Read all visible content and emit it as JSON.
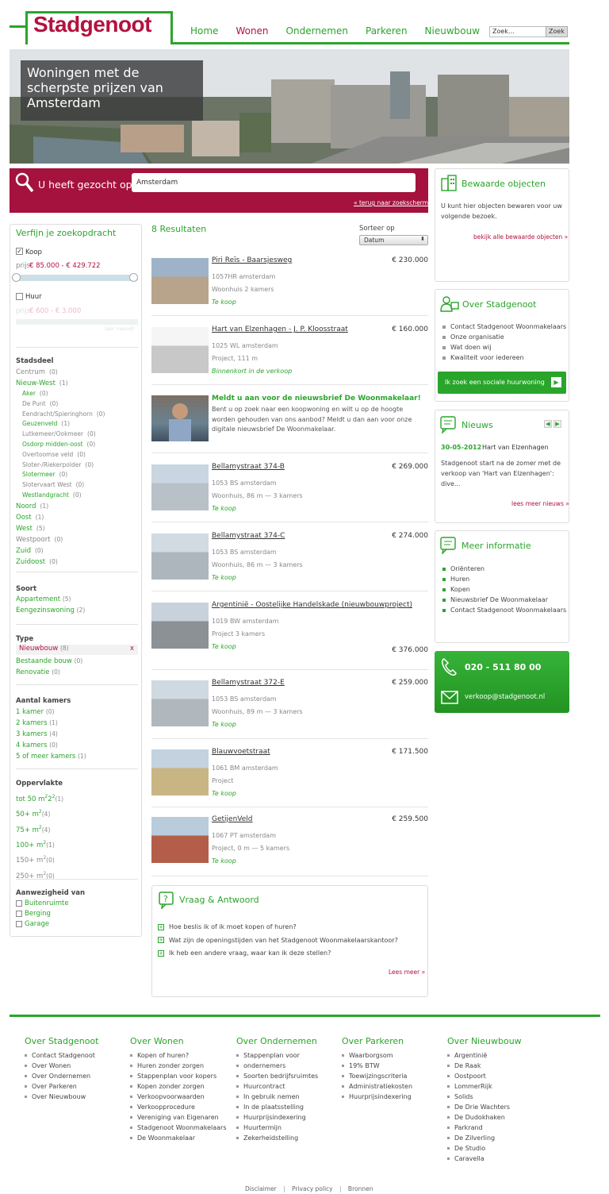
{
  "header": {
    "logo": "Stadgenoot",
    "nav": [
      "Home",
      "Wonen",
      "Ondernemen",
      "Parkeren",
      "Nieuwbouw"
    ],
    "active_nav": "Wonen",
    "search_placeholder": "Zoek...",
    "search_button": "Zoek"
  },
  "hero": {
    "title": "Woningen met de scherpste prijzen van Amsterdam"
  },
  "searchbar": {
    "label": "U heeft gezocht op:",
    "value": "Amsterdam",
    "back_link": "« terug naar zoekscherm"
  },
  "filter": {
    "title": "Verfijn je zoekopdracht",
    "koop_label": "Koop",
    "koop_price_prefix": "prijs",
    "koop_price": "€ 85.000 - € 429.722",
    "huur_label": "Huur",
    "huur_price_prefix": "prijs",
    "huur_price": "€ 600 - € 3.000",
    "huur_note": "(per maand)",
    "stadsdeel_title": "Stadsdeel",
    "stadsdeel": [
      {
        "label": "Centrum",
        "count": "(0)",
        "level": 0,
        "color": "grey"
      },
      {
        "label": "Nieuw-West",
        "count": "(1)",
        "level": 0,
        "color": "green"
      },
      {
        "label": "Aker",
        "count": "(0)",
        "level": 1,
        "color": "green"
      },
      {
        "label": "De Punt",
        "count": "(0)",
        "level": 1,
        "color": "grey"
      },
      {
        "label": "Eendracht/Spieringhorn",
        "count": "(0)",
        "level": 1,
        "color": "grey"
      },
      {
        "label": "Geuzenveld",
        "count": "(1)",
        "level": 1,
        "color": "green"
      },
      {
        "label": "Lutkemeer/Ookmeer",
        "count": "(0)",
        "level": 1,
        "color": "grey"
      },
      {
        "label": "Osdorp midden-oost",
        "count": "(0)",
        "level": 1,
        "color": "green"
      },
      {
        "label": "Overtoomse veld",
        "count": "(0)",
        "level": 1,
        "color": "grey"
      },
      {
        "label": "Sloter-/Riekerpolder",
        "count": "(0)",
        "level": 1,
        "color": "grey"
      },
      {
        "label": "Slotermeer",
        "count": "(0)",
        "level": 1,
        "color": "green"
      },
      {
        "label": "Slotervaart West",
        "count": "(0)",
        "level": 1,
        "color": "grey"
      },
      {
        "label": "Westlandgracht",
        "count": "(0)",
        "level": 1,
        "color": "green"
      },
      {
        "label": "Noord",
        "count": "(1)",
        "level": 0,
        "color": "green"
      },
      {
        "label": "Oost",
        "count": "(1)",
        "level": 0,
        "color": "green"
      },
      {
        "label": "West",
        "count": "(5)",
        "level": 0,
        "color": "green"
      },
      {
        "label": "Westpoort",
        "count": "(0)",
        "level": 0,
        "color": "grey"
      },
      {
        "label": "Zuid",
        "count": "(0)",
        "level": 0,
        "color": "green"
      },
      {
        "label": "Zuidoost",
        "count": "(0)",
        "level": 0,
        "color": "green"
      }
    ],
    "soort_title": "Soort",
    "soort": [
      {
        "label": "Appartement",
        "count": "(5)"
      },
      {
        "label": "Eengezinswoning",
        "count": "(2)"
      }
    ],
    "type_title": "Type",
    "type_selected": {
      "label": "Nieuwbouw",
      "count": "(8)",
      "remove": "x"
    },
    "type": [
      {
        "label": "Bestaande bouw",
        "count": "(0)"
      },
      {
        "label": "Renovatie",
        "count": "(0)"
      }
    ],
    "kamers_title": "Aantal kamers",
    "kamers": [
      {
        "label": "1 kamer",
        "count": "(0)"
      },
      {
        "label": "2 kamers",
        "count": "(1)"
      },
      {
        "label": "3 kamers",
        "count": "(4)"
      },
      {
        "label": "4 kamers",
        "count": "(0)"
      },
      {
        "label": "5 of meer kamers",
        "count": "(1)"
      }
    ],
    "opp_title": "Oppervlakte",
    "opp": [
      {
        "label": "tot 50 m",
        "count": "(1)",
        "color": "green"
      },
      {
        "label": "50+ m",
        "count": "(4)",
        "color": "green"
      },
      {
        "label": "75+ m",
        "count": "(4)",
        "color": "green"
      },
      {
        "label": "100+ m",
        "count": "(1)",
        "color": "green"
      },
      {
        "label": "150+ m",
        "count": "(0)",
        "color": "grey"
      },
      {
        "label": "250+ m",
        "count": "(0)",
        "color": "grey"
      }
    ],
    "aanw_title": "Aanwezigheid van",
    "aanw": [
      "Buitenruimte",
      "Berging",
      "Garage"
    ]
  },
  "results": {
    "count_label": "8 Resultaten",
    "sort_label": "Sorteer op",
    "sort_value": "Datum",
    "items": [
      {
        "title": "Piri Reïs - Baarsjesweg",
        "price": "€ 230.000",
        "addr": "1057HR amsterdam",
        "type": "Woonhuis 2 kamers",
        "status": "Te koop"
      },
      {
        "title": "Hart van Elzenhagen - J. P. Kloosstraat",
        "price": "€ 160.000",
        "addr": "1025 WL amsterdam",
        "type": "Project, 111 m",
        "status": "Binnenkort in de verkoop"
      },
      {
        "title": "Bellamystraat 374-B",
        "price": "€ 269.000",
        "addr": "1053 BS amsterdam",
        "type": "Woonhuis, 86 m — 3 kamers",
        "status": "Te koop"
      },
      {
        "title": "Bellamystraat 374-C",
        "price": "€ 274.000",
        "addr": "1053 BS amsterdam",
        "type": "Woonhuis, 86 m — 3 kamers",
        "status": "Te koop"
      },
      {
        "title": "Argentinië - Oostelijke Handelskade (nieuwbouwproject)",
        "price": "€ 376.000",
        "addr": "1019 BW amsterdam",
        "type": "Project 3 kamers",
        "status": "Te koop"
      },
      {
        "title": "Bellamystraat 372-E",
        "price": "€ 259.000",
        "addr": "1053 BS amsterdam",
        "type": "Woonhuis, 89 m — 3 kamers",
        "status": "Te koop"
      },
      {
        "title": "Blauwvoetstraat",
        "price": "€ 171.500",
        "addr": "1061 BM amsterdam",
        "type": "Project",
        "status": "Te koop"
      },
      {
        "title": "GetijenVeld",
        "price": "€ 259.500",
        "addr": "1067 PT amsterdam",
        "type": "Project, 0 m — 5 kamers",
        "status": "Te koop"
      }
    ],
    "promo_title": "Meldt u aan voor de nieuwsbrief De Woonmakelaar!",
    "promo_text": "Bent u op zoek naar een koopwoning en wilt u op de hoogte worden gehouden van ons aanbod? Meldt u dan aan voor onze digitale nieuwsbrief De Woonmakelaar."
  },
  "faq": {
    "title": "Vraag & Antwoord",
    "items": [
      "Hoe beslis ik of ik moet kopen of huren?",
      "Wat zijn de openingstijden van het Stadgenoot Woonmakelaarskantoor?",
      "Ik heb een andere vraag, waar kan ik deze stellen?"
    ],
    "more": "Lees meer »"
  },
  "sidebar": {
    "saved_title": "Bewaarde objecten",
    "saved_text": "U kunt hier objecten bewaren voor uw volgende bezoek.",
    "saved_link": "bekijk alle bewaarde objecten »",
    "over_title": "Over Stadgenoot",
    "over_items": [
      "Contact Stadgenoot Woonmakelaars",
      "Onze organisatie",
      "Wat doen wij",
      "Kwaliteit voor iedereen"
    ],
    "social_btn": "Ik zoek een sociale huurwoning",
    "news_title": "Nieuws",
    "news_date": "30-05-2012",
    "news_head": "Hart van Elzenhagen",
    "news_text": "Stadgenoot start na de zomer met de verkoop van 'Hart van Elzenhagen': dive...",
    "news_more": "lees meer nieuws »",
    "info_title": "Meer informatie",
    "info_items": [
      "Oriënteren",
      "Huren",
      "Kopen",
      "Nieuwsbrief De Woonmakelaar",
      "Contact Stadgenoot Woonmakelaars"
    ],
    "phone": "020 - 511 80 00",
    "email": "verkoop@stadgenoot.nl"
  },
  "footer": {
    "cols": [
      {
        "title": "Over Stadgenoot",
        "items": [
          "Contact Stadgenoot",
          "Over Wonen",
          "Over Ondernemen",
          "Over Parkeren",
          "Over Nieuwbouw"
        ]
      },
      {
        "title": "Over Wonen",
        "items": [
          "Kopen of huren?",
          "Huren zonder zorgen",
          "Stappenplan voor kopers",
          "Kopen zonder zorgen",
          "Verkoopvoorwaarden",
          "Verkoopprocedure",
          "Vereniging van Eigenaren",
          "Stadgenoot Woonmakelaars",
          "De Woonmakelaar"
        ]
      },
      {
        "title": "Over Ondernemen",
        "items": [
          "Stappenplan voor",
          "ondernemers",
          "Soorten bedrijfsruimtes",
          "Huurcontract",
          "In gebruik nemen",
          "In de plaatsstelling",
          "Huurprijsindexering",
          "Huurtermijn",
          "Zekerheidstelling"
        ]
      },
      {
        "title": "Over Parkeren",
        "items": [
          "Waarborgsom",
          "19% BTW",
          "Toewijzingscriteria",
          "Administratiekosten",
          "Huurprijsindexering"
        ]
      },
      {
        "title": "Over Nieuwbouw",
        "items": [
          "Argentinië",
          "De Raak",
          "Oostpoort",
          "LommerRijk",
          "Solids",
          "De Drie Wachters",
          "De Dudokhaken",
          "Parkrand",
          "De Zilverling",
          "De Studio",
          "Caravella"
        ]
      }
    ],
    "bottom": [
      "Disclaimer",
      "Privacy policy",
      "Bronnen"
    ]
  },
  "colors": {
    "green": "#2aa52b",
    "red": "#b3123f",
    "dark_red": "#a4123d"
  }
}
